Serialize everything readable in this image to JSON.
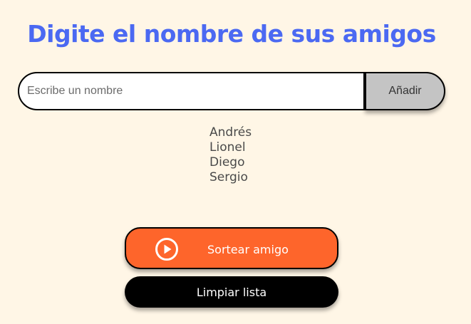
{
  "header": {
    "title": "Digite el nombre de sus amigos"
  },
  "form": {
    "input_placeholder": "Escribe un nombre",
    "input_value": "",
    "add_button_label": "Añadir"
  },
  "friends": [
    "Andrés",
    "Lionel",
    "Diego",
    "Sergio"
  ],
  "actions": {
    "draw_label": "Sortear amigo",
    "draw_icon": "play-circle-icon",
    "clear_label": "Limpiar lista"
  },
  "colors": {
    "background": "#fff6e6",
    "title": "#4b69f2",
    "draw_button": "#fe652b",
    "clear_button": "#000000",
    "add_button": "#c4c4c4"
  }
}
